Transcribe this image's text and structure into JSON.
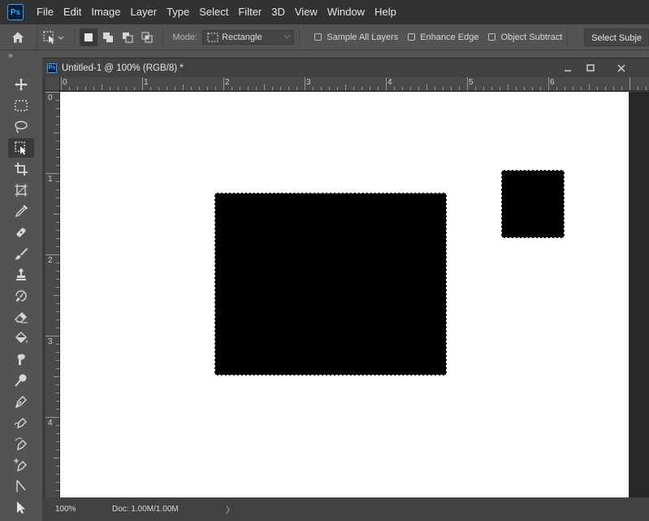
{
  "app": {
    "logo": "Ps"
  },
  "menubar": {
    "items": [
      "File",
      "Edit",
      "Image",
      "Layer",
      "Type",
      "Select",
      "Filter",
      "3D",
      "View",
      "Window",
      "Help"
    ]
  },
  "options": {
    "mode_label": "Mode:",
    "mode_value": "Rectangle",
    "sample_all_layers": "Sample All Layers",
    "enhance_edge": "Enhance Edge",
    "object_subtract": "Object Subtract",
    "select_subject": "Select Subje"
  },
  "document": {
    "title": "Untitled-1 @ 100% (RGB/8) *",
    "doc_icon": "Ps"
  },
  "rulers": {
    "horizontal": [
      "0",
      "1",
      "2",
      "3",
      "4",
      "5",
      "6"
    ],
    "vertical": [
      "0",
      "1",
      "2",
      "3",
      "4"
    ]
  },
  "status": {
    "zoom": "100%",
    "doc": "Doc: 1.00M/1.00M",
    "arrow": "〉"
  },
  "colors": {
    "menubar": "#323232",
    "panel": "#535353",
    "canvas": "#ffffff",
    "shape": "#000000",
    "accent": "#31a8ff"
  },
  "tools": [
    "move-tool",
    "rectangular-marquee-tool",
    "lasso-tool",
    "object-selection-tool",
    "crop-tool",
    "frame-tool",
    "eyedropper-tool",
    "spot-healing-tool",
    "brush-tool",
    "clone-stamp-tool",
    "history-brush-tool",
    "eraser-tool",
    "paint-bucket-tool",
    "smudge-tool",
    "dodge-tool",
    "pen-tool",
    "freeform-pen-tool",
    "curvature-pen-tool",
    "add-anchor-tool",
    "path-selection-tool",
    "direct-selection-tool"
  ]
}
